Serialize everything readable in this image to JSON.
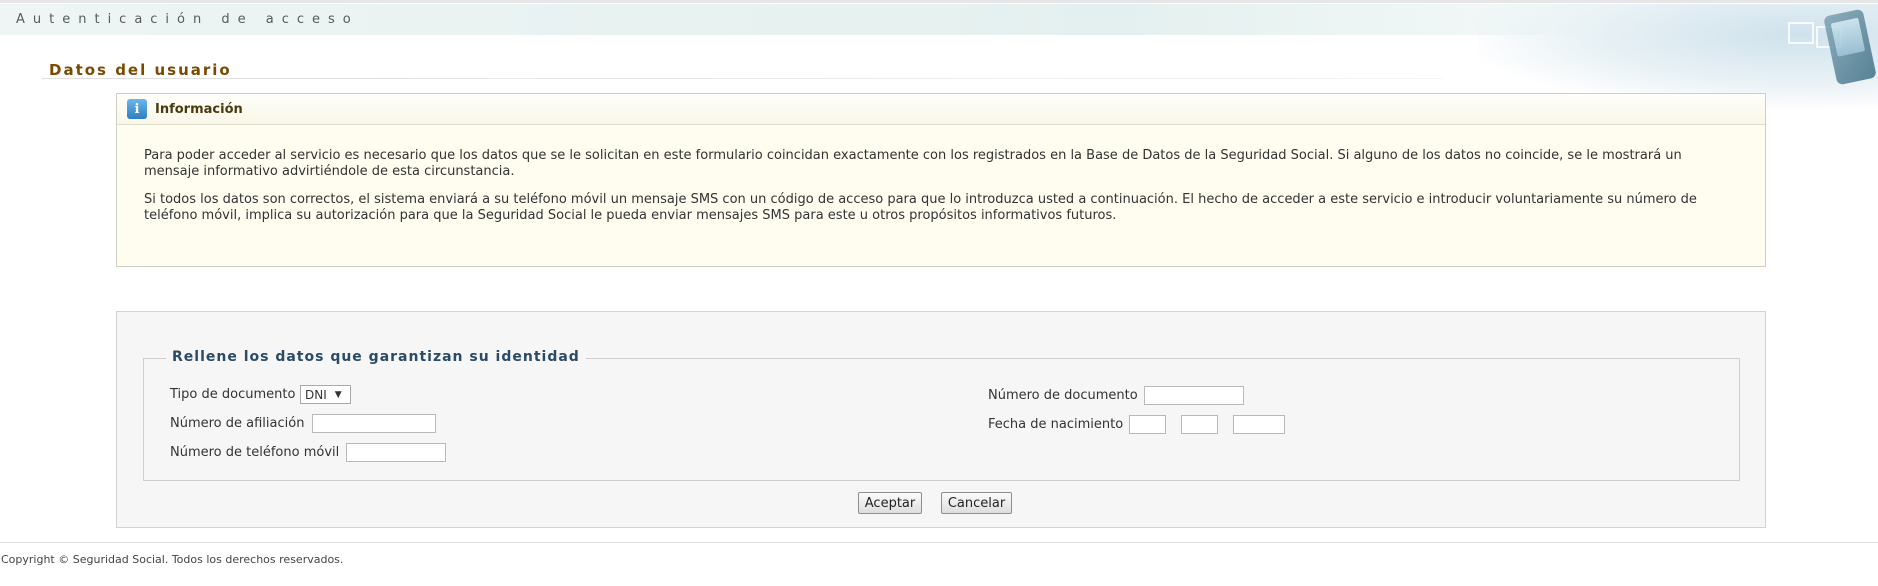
{
  "header": {
    "banner_title": "Autenticación de acceso"
  },
  "section": {
    "title": "Datos del usuario"
  },
  "info_box": {
    "title": "Información",
    "icon": "info-icon",
    "paragraph_1": "Para poder acceder al servicio es necesario que los datos que se le solicitan en este formulario coincidan exactamente con los registrados en la Base de Datos de la Seguridad Social. Si alguno de los datos no coincide, se le mostrará un mensaje informativo advirtiéndole de esta circunstancia.",
    "paragraph_2": "Si todos los datos son correctos, el sistema enviará a su teléfono móvil un mensaje SMS con un código de acceso para que lo introduzca usted a continuación. El hecho de acceder a este servicio e introducir voluntariamente su número de teléfono móvil, implica su autorización para que la Seguridad Social le pueda enviar mensajes SMS para este u otros propósitos informativos futuros."
  },
  "form": {
    "legend": "Rellene los datos que garantizan su identidad",
    "document_type": {
      "label": "Tipo de documento",
      "value": "DNI"
    },
    "affiliation_number": {
      "label": "Número de afiliación",
      "value": ""
    },
    "mobile_phone": {
      "label": "Número de teléfono móvil",
      "value": ""
    },
    "document_number": {
      "label": "Número de documento",
      "value": ""
    },
    "birth_date": {
      "label": "Fecha de nacimiento",
      "day": "",
      "month": "",
      "year": ""
    },
    "accept_label": "Aceptar",
    "cancel_label": "Cancelar"
  },
  "footer": {
    "copyright": "Copyright © Seguridad Social. Todos los derechos reservados."
  },
  "colors": {
    "section_title": "#7a4a00",
    "legend": "#2b4a66",
    "info_bg": "#fefdf0"
  }
}
